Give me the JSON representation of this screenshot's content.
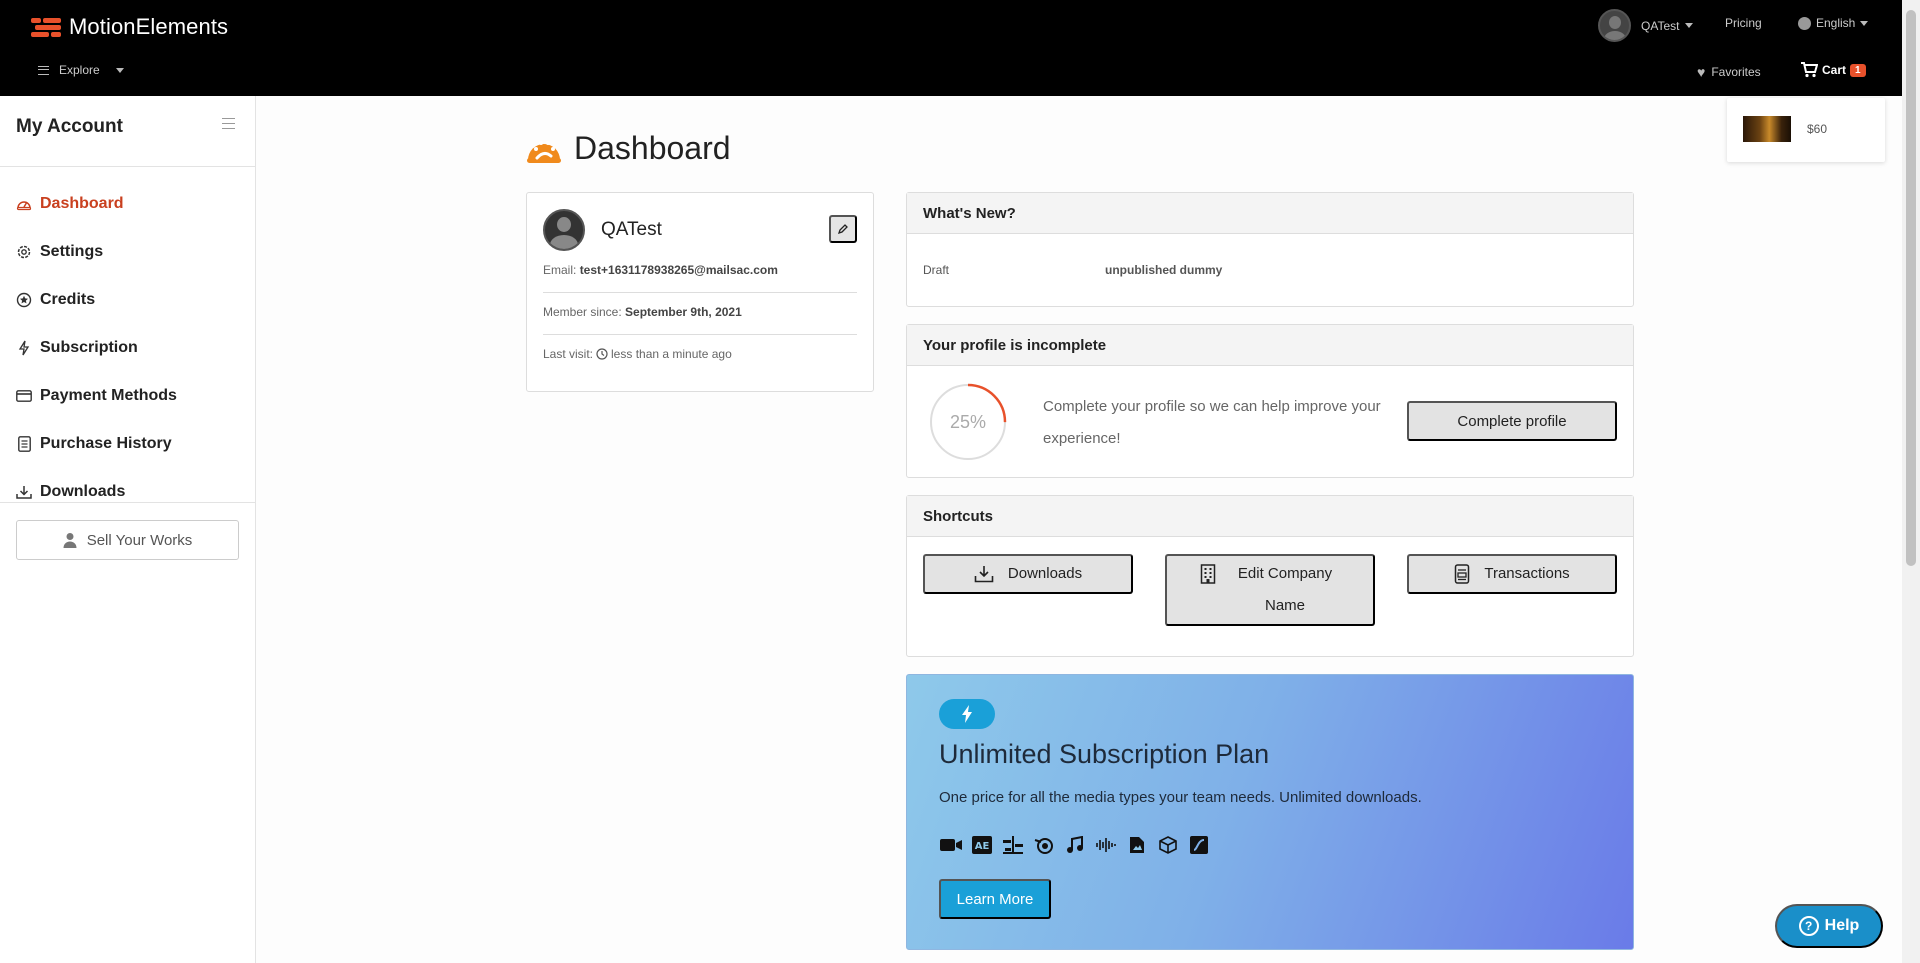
{
  "header": {
    "brand": "MotionElements",
    "explore": "Explore",
    "user": "QATest",
    "pricing": "Pricing",
    "language": "English",
    "favorites": "Favorites",
    "cart_label": "Cart",
    "cart_count": "1"
  },
  "cart_popup": {
    "price": "$60"
  },
  "sidebar": {
    "title": "My Account",
    "items": [
      {
        "label": "Dashboard",
        "icon": "gauge-icon"
      },
      {
        "label": "Settings",
        "icon": "gear-icon"
      },
      {
        "label": "Credits",
        "icon": "star-circle-icon"
      },
      {
        "label": "Subscription",
        "icon": "bolt-icon"
      },
      {
        "label": "Payment Methods",
        "icon": "credit-card-icon"
      },
      {
        "label": "Purchase History",
        "icon": "receipt-icon"
      },
      {
        "label": "Downloads",
        "icon": "download-icon"
      }
    ],
    "sell_button": "Sell Your Works"
  },
  "main": {
    "title": "Dashboard",
    "profile": {
      "name": "QATest",
      "email_label": "Email:",
      "email": "test+1631178938265@mailsac.com",
      "member_label": "Member since:",
      "member_since": "September 9th, 2021",
      "last_visit_label": "Last visit:",
      "last_visit": "less than a minute ago"
    },
    "whats_new": {
      "title": "What's New?",
      "label": "Draft",
      "value": "unpublished dummy"
    },
    "incomplete": {
      "title": "Your profile is incomplete",
      "percent_text": "25%",
      "percent": 0.25,
      "message": "Complete your profile so we can help improve your experience!",
      "button": "Complete profile"
    },
    "shortcuts": {
      "title": "Shortcuts",
      "downloads": "Downloads",
      "edit_company": "Edit Company Name",
      "transactions": "Transactions"
    },
    "promo": {
      "title": "Unlimited Subscription Plan",
      "subtitle": "One price for all the media types your team needs. Unlimited downloads.",
      "button": "Learn More",
      "media_icons": [
        "video-icon",
        "after-effects-icon",
        "premiere-icon",
        "motion-icon",
        "music-icon",
        "sound-effects-icon",
        "image-icon",
        "3d-model-icon",
        "lottie-icon"
      ]
    }
  },
  "help": {
    "label": "Help"
  },
  "colors": {
    "accent": "#e8512b",
    "active_nav": "#c9401f",
    "promo_button": "#1aa0d8",
    "help_button": "#1a8fc9"
  }
}
